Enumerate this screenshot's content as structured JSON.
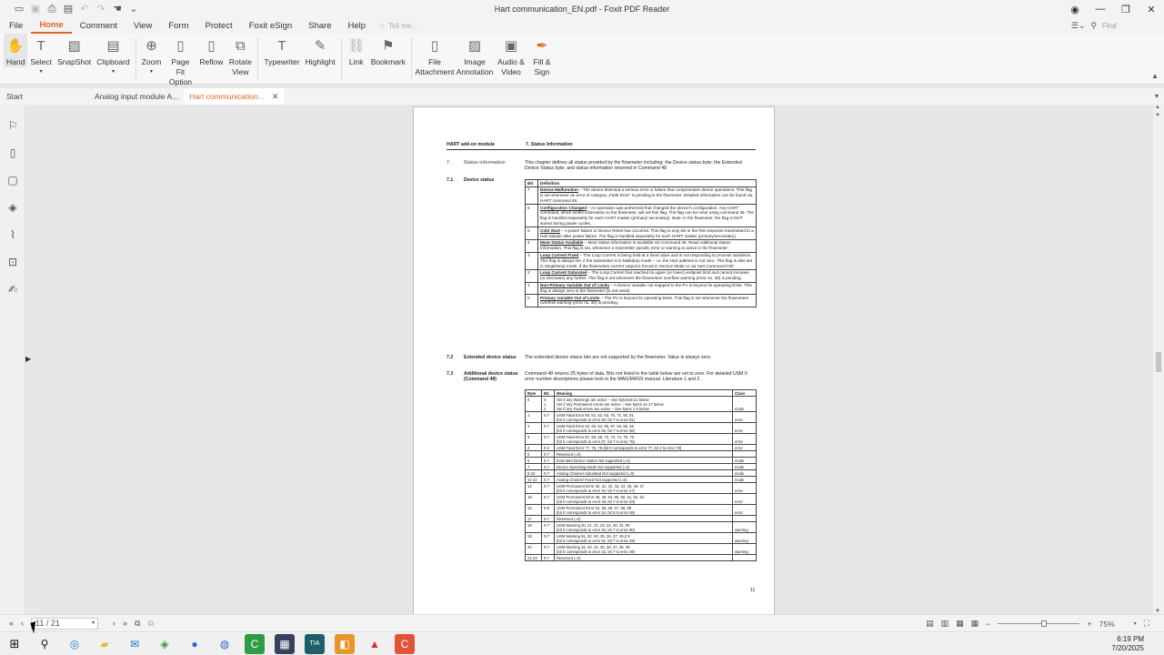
{
  "window": {
    "title": "Hart communication_EN.pdf - Foxit PDF Reader"
  },
  "quick_access": [
    "folder-icon",
    "save-icon",
    "print-icon",
    "undo-icon",
    "redo-icon",
    "hand-icon",
    "customize-icon"
  ],
  "menu": {
    "file": "File",
    "tabs": [
      "Home",
      "Comment",
      "View",
      "Form",
      "Protect",
      "Foxit eSign",
      "Share",
      "Help"
    ],
    "tell_me_placeholder": "Tell me...",
    "find_placeholder": "Find"
  },
  "ribbon": {
    "buttons": [
      {
        "label": "Hand",
        "icon": "hand-icon"
      },
      {
        "label": "Select",
        "icon": "select-icon"
      },
      {
        "label": "SnapShot",
        "icon": "snapshot-icon"
      },
      {
        "label": "Clipboard",
        "icon": "clipboard-icon"
      },
      {
        "label": "Zoom",
        "icon": "zoom-icon"
      },
      {
        "label": "Page Fit Option",
        "icon": "page-fit-icon"
      },
      {
        "label": "Reflow",
        "icon": "reflow-icon"
      },
      {
        "label": "Rotate View",
        "icon": "rotate-icon"
      },
      {
        "label": "Typewriter",
        "icon": "typewriter-icon"
      },
      {
        "label": "Highlight",
        "icon": "highlight-icon"
      },
      {
        "label": "Link",
        "icon": "link-icon"
      },
      {
        "label": "Bookmark",
        "icon": "bookmark-icon"
      },
      {
        "label": "File Attachment",
        "icon": "attachment-icon"
      },
      {
        "label": "Image Annotation",
        "icon": "image-icon"
      },
      {
        "label": "Audio & Video",
        "icon": "video-icon"
      },
      {
        "label": "Fill & Sign",
        "icon": "pen-icon"
      }
    ]
  },
  "doc_tabs": {
    "start": "Start",
    "tabs": [
      "Analog input module A...",
      "Hart communication..."
    ]
  },
  "document": {
    "header_left": "HART add-on module",
    "header_right": "7. Status Information",
    "sec7_num": "7.",
    "sec7_title": "Status information",
    "sec7_text": "This chapter defines all status provided by the flowmeter including: the Device status byte; the Extended Device Status byte; and status information returned in Command 48",
    "sec71_num": "7.1",
    "sec71_title": "Device status",
    "device_status_header": [
      "Bit",
      "Definition"
    ],
    "device_status_rows": [
      {
        "bit": "7",
        "name": "Device Malfunction",
        "text": " – The device detected a serious error or failure that compromises device operations. This flag is set whenever an error of category „Fatal Error\" is pending in the flowmeter. Detailed information can be found via HART command 48."
      },
      {
        "bit": "6",
        "name": "Configuration Changed",
        "text": " – An operation was performed that changed the device's configuration. Any HART command, which writes information to the flowmeter, will set this flag. The flag can be reset using command 38. The flag is handled separately for each HART master (primary/ secondary). Note: In the flowmeter, the flag is NOT stored during power cycles."
      },
      {
        "bit": "5",
        "name": "Cold Start",
        "text": " – A power failure or Device Reset has occurred. This flag is only set in the first response transmitted to a Hart Master after power failure. The flag is handled separately for each HART master (primary/secondary)."
      },
      {
        "bit": "4",
        "name": "More Status Available",
        "text": " – More status information is available via Command 48, Read Additional Status Information. This flag is set, whenever a transmitter specific error or warning is active in the flowmeter."
      },
      {
        "bit": "3",
        "name": "Loop Current Fixed",
        "text": " – The Loop Current is being held at a fixed value and is not responding to process variations. This flag is always set, if the transmitter is in Multidrop mode – i.e. the Hart address is not zero. This flag is also set in SingleDrop mode, if the flowmeters current output is forced in Service Mode or via Hart Command #40."
      },
      {
        "bit": "2",
        "name": "Loop Current Saturated",
        "text": " – The Loop Current has reached its upper (or lower) endpoint limit and cannot increase (or decrease) any further. This flag is set whenever the flowmeters overflow warning (error no. 30) is pending."
      },
      {
        "bit": "1",
        "name": "Non-Primary Variable Out of Limits",
        "text": " – A Device Variable not mapped to the PV is beyond its operating limits. This flag is always zero in the flowmeter (ie not used)."
      },
      {
        "bit": "0",
        "name": "Primary Variable Out of Limits",
        "text": " – The PV is beyond its operating limits. This flag is set whenever the flowmeters overflow warning (error no. 30) is pending."
      }
    ],
    "sec72_num": "7.2",
    "sec72_title": "Extended device status",
    "sec72_text": "The extended device status bits are not supported by the flowmeter. Value is always zero.",
    "sec73_num": "7.3",
    "sec73_title": "Additional device status (Command 48)",
    "sec73_text": "Command 48 returns 25 bytes of data. Bits not listed in the table below are set to zero. For detailed USM II error number descriptions please look in the MAG/MASS manual. Literature 1 and 2.",
    "cmd48_header": [
      "Byte",
      "Bit",
      "Meaning",
      "Class"
    ],
    "cmd48_rows": [
      {
        "byte": "0",
        "bit": "0\n1\n2",
        "meaning": "Set if any Warnings are active – See bytes18-21 below\nSet if any Permanent errors are active – See bytes 14-17 below\nSet if any Fatal errors are active – See bytes 1-5 below",
        "cls": "mode"
      },
      {
        "byte": "1",
        "bit": "0-7",
        "meaning": "USM Fatal Error 60, 61, 62, 63, 70, 71, 80, 81\n(bit 0 corresponds to error 60, bit 7 to error 81)",
        "cls": "error"
      },
      {
        "byte": "2",
        "bit": "0-7",
        "meaning": "USM Fatal Error 82, 83, 84, 96, 97, 64, 65, 66\n(bit 0 corresponds to error 82, bit 7 to error 66)",
        "cls": "error"
      },
      {
        "byte": "3",
        "bit": "0-7",
        "meaning": "USM Fatal Error 67, 68, 69, 72, 73, 74, 75, 76\n(bit 0 corresponds to error 67, bit 7 to error 76)",
        "cls": "error"
      },
      {
        "byte": "4",
        "bit": "0-2",
        "meaning": "USM Fatal Error 77, 78, 79 (bit 0 corresponds to error 77, bit 2 to error 79)",
        "cls": "error"
      },
      {
        "byte": "5",
        "bit": "0-7",
        "meaning": "Reserved (=0)",
        "cls": ""
      },
      {
        "byte": "6",
        "bit": "0-7",
        "meaning": "Extended Device Status Not supported (=0)",
        "cls": "mode"
      },
      {
        "byte": "7",
        "bit": "0-7",
        "meaning": "Device Operating Mode Not supported (=0)",
        "cls": "mode"
      },
      {
        "byte": "8-10",
        "bit": "0-7",
        "meaning": "Analog Channel Saturated Not supported (=0)",
        "cls": "mode"
      },
      {
        "byte": "11-13",
        "bit": "0-7",
        "meaning": "Analog Channel Fixed Not supported (=0)",
        "cls": "mode"
      },
      {
        "byte": "14",
        "bit": "0-7",
        "meaning": "USM Permanent Error 40, 41, 42, 43, 44, 45, 46, 47\n(bit 0 corresponds to error 40, bit 7 to error 47)",
        "cls": "error"
      },
      {
        "byte": "15",
        "bit": "0-7",
        "meaning": "USM Permanent Error 48, 49, 94, 95, 50, 51, 52, 53\n(bit 0 corresponds to error 48, bit 7 to error 53)",
        "cls": "error"
      },
      {
        "byte": "16",
        "bit": "0-5",
        "meaning": "USM Permanent Error 54, 55, 56, 57, 58, 59\n(bit 0 corresponds to error 54, bit 5 to error 59)",
        "cls": "error"
      },
      {
        "byte": "17",
        "bit": "0-7",
        "meaning": "Reserved (=0)",
        "cls": ""
      },
      {
        "byte": "18",
        "bit": "0-7",
        "meaning": "USM Warning 20, 21, 22, 23, 24, 30, 31, 90\n(bit 0 corresponds to error 20, bit 7 to error 90)",
        "cls": "warning"
      },
      {
        "byte": "19",
        "bit": "0-7",
        "meaning": "USM Warning 91, 92, 93, 25, 26, 27, 28,2 9\n(bit 0 corresponds to error 91, bit 7 to error 29)",
        "cls": "warning"
      },
      {
        "byte": "20",
        "bit": "0-7",
        "meaning": "USM Warning 32, 33, 34, 35, 36, 37, 38, 39\n(bit 0 corresponds to error 32, bit 7 to error 39)",
        "cls": "warning"
      },
      {
        "byte": "21-24",
        "bit": "0-7",
        "meaning": "Reserved (=0)",
        "cls": ""
      }
    ],
    "page_number": "11"
  },
  "statusbar": {
    "page_indicator": "11 / 21",
    "zoom": "75%"
  },
  "taskbar": {
    "time": "6:19 PM",
    "date": "7/20/2025"
  },
  "colors": {
    "accent": "#e1652a"
  }
}
